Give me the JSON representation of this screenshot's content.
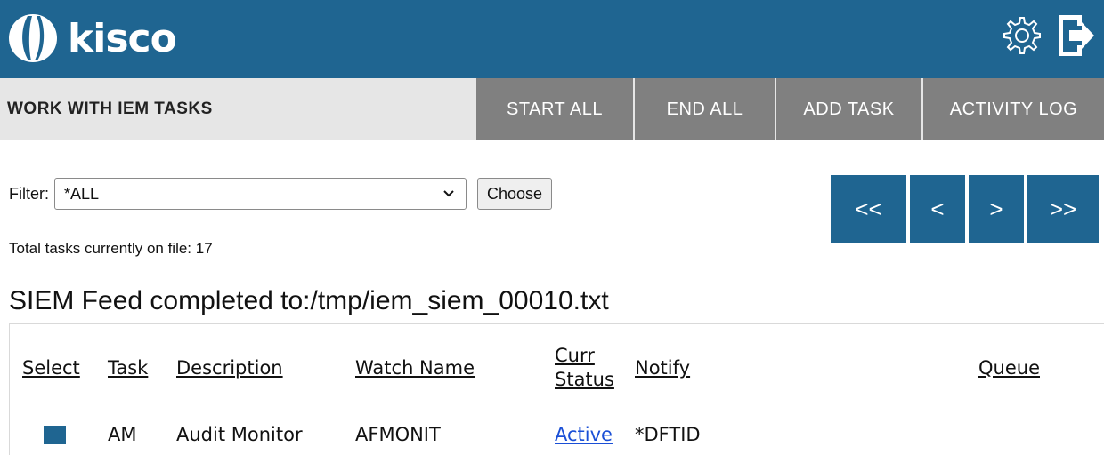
{
  "header": {
    "logo_text": "kisco",
    "brand_color": "#1f6591",
    "icons": [
      "gear-icon",
      "logout-icon"
    ]
  },
  "toolbar": {
    "title": "WORK WITH IEM TASKS",
    "start_all": "START ALL",
    "end_all": "END ALL",
    "add_task": "ADD TASK",
    "activity_log": "ACTIVITY LOG"
  },
  "filter": {
    "label": "Filter:",
    "selected": "*ALL",
    "choose_label": "Choose"
  },
  "total_text": "Total tasks currently on file: 17",
  "pager": {
    "first": "<<",
    "prev": "<",
    "next": ">",
    "last": ">>"
  },
  "message": "SIEM Feed completed to:/tmp/iem_siem_00010.txt",
  "table": {
    "columns": {
      "select": "Select",
      "task": "Task",
      "description": "Description",
      "watch_name": "Watch Name",
      "curr_status_1": "Curr",
      "curr_status_2": "Status",
      "notify": "Notify",
      "queue": "Queue"
    },
    "rows": [
      {
        "task": "AM",
        "description": "Audit Monitor",
        "watch_name": "AFMONIT",
        "status": "Active",
        "notify": "*DFTID",
        "queue": ""
      }
    ]
  }
}
